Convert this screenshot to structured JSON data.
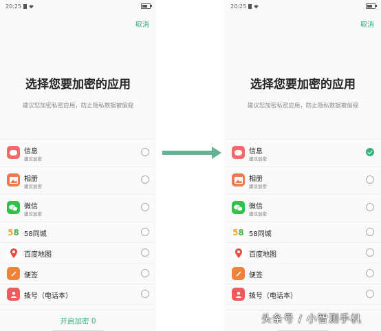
{
  "status": {
    "time": "20:25"
  },
  "header": {
    "cancel_label": "取消"
  },
  "title": "选择您要加密的应用",
  "subtitle": "建议您加密私密应用，防止隐私数据被偷窥",
  "apps": [
    {
      "name": "信息",
      "sub": "建议加密",
      "icon": "message-icon",
      "color": "#f06a6a"
    },
    {
      "name": "相册",
      "sub": "建议加密",
      "icon": "gallery-icon",
      "color": "#f07a4f"
    },
    {
      "name": "微信",
      "sub": "建议加密",
      "icon": "wechat-icon",
      "color": "#2dc24a"
    },
    {
      "name": "58同城",
      "sub": "",
      "icon": "58-icon",
      "color": "#ffffff"
    },
    {
      "name": "百度地图",
      "sub": "",
      "icon": "map-pin-icon",
      "color": "#ffffff"
    },
    {
      "name": "便签",
      "sub": "",
      "icon": "notes-icon",
      "color": "#f0813a"
    },
    {
      "name": "拨号（电话本）",
      "sub": "",
      "icon": "contacts-icon",
      "color": "#ef5a5a"
    }
  ],
  "bottom": {
    "enable_label": "开启加密 0"
  },
  "watermark": "头条号 / 小智测手机",
  "before": {
    "checked": [
      false,
      false,
      false,
      false,
      false,
      false,
      false
    ]
  },
  "after": {
    "checked": [
      true,
      false,
      false,
      false,
      false,
      false,
      false
    ]
  },
  "colors": {
    "accent": "#33b37a",
    "arrow": "#5fb592"
  }
}
